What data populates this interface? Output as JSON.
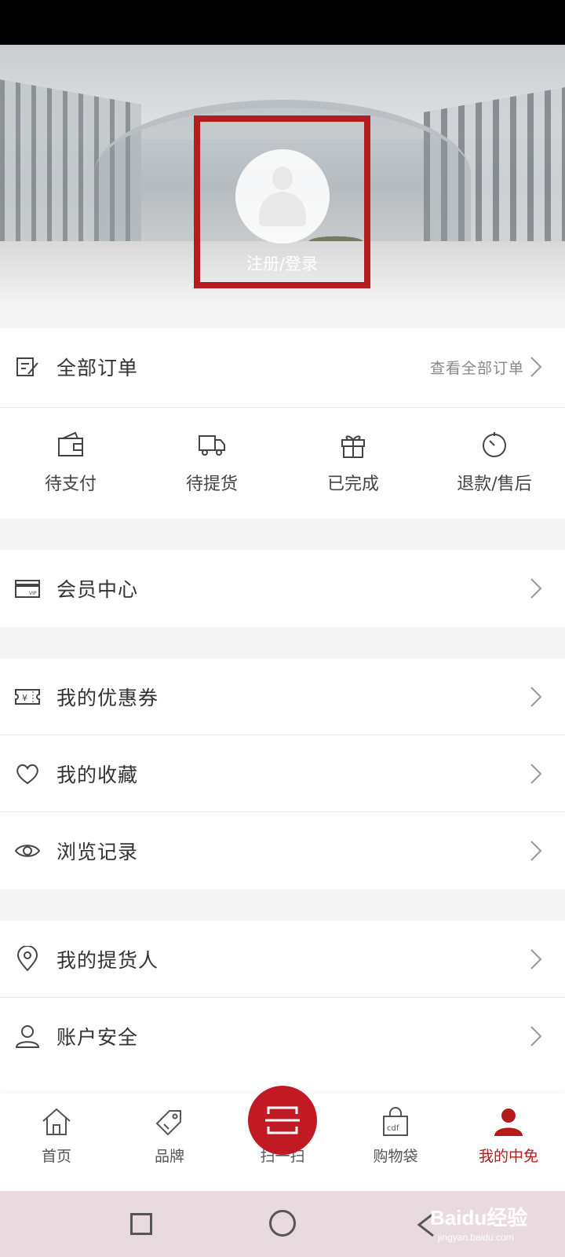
{
  "hero": {
    "login_label": "注册/登录"
  },
  "orders": {
    "title": "全部订单",
    "view_all": "查看全部订单",
    "statuses": [
      {
        "label": "待支付",
        "icon": "wallet-icon"
      },
      {
        "label": "待提货",
        "icon": "truck-icon"
      },
      {
        "label": "已完成",
        "icon": "gift-icon"
      },
      {
        "label": "退款/售后",
        "icon": "timer-icon"
      }
    ]
  },
  "menu": {
    "member_center": "会员中心",
    "coupons": "我的优惠券",
    "favorites": "我的收藏",
    "history": "浏览记录",
    "pickup_person": "我的提货人",
    "account_security": "账户安全"
  },
  "tabbar": {
    "items": [
      {
        "label": "首页",
        "icon": "home-icon"
      },
      {
        "label": "品牌",
        "icon": "tag-icon"
      },
      {
        "label": "扫一扫",
        "icon": "scan-icon"
      },
      {
        "label": "购物袋",
        "icon": "shopping-bag-icon"
      },
      {
        "label": "我的中免",
        "icon": "user-icon",
        "active": true
      }
    ]
  },
  "colors": {
    "accent": "#b31b1b",
    "scan_button": "#c21a24",
    "highlight_box": "#b41d1d"
  },
  "watermark": {
    "brand": "Baidu经验",
    "url": "jingyan.baidu.com"
  }
}
